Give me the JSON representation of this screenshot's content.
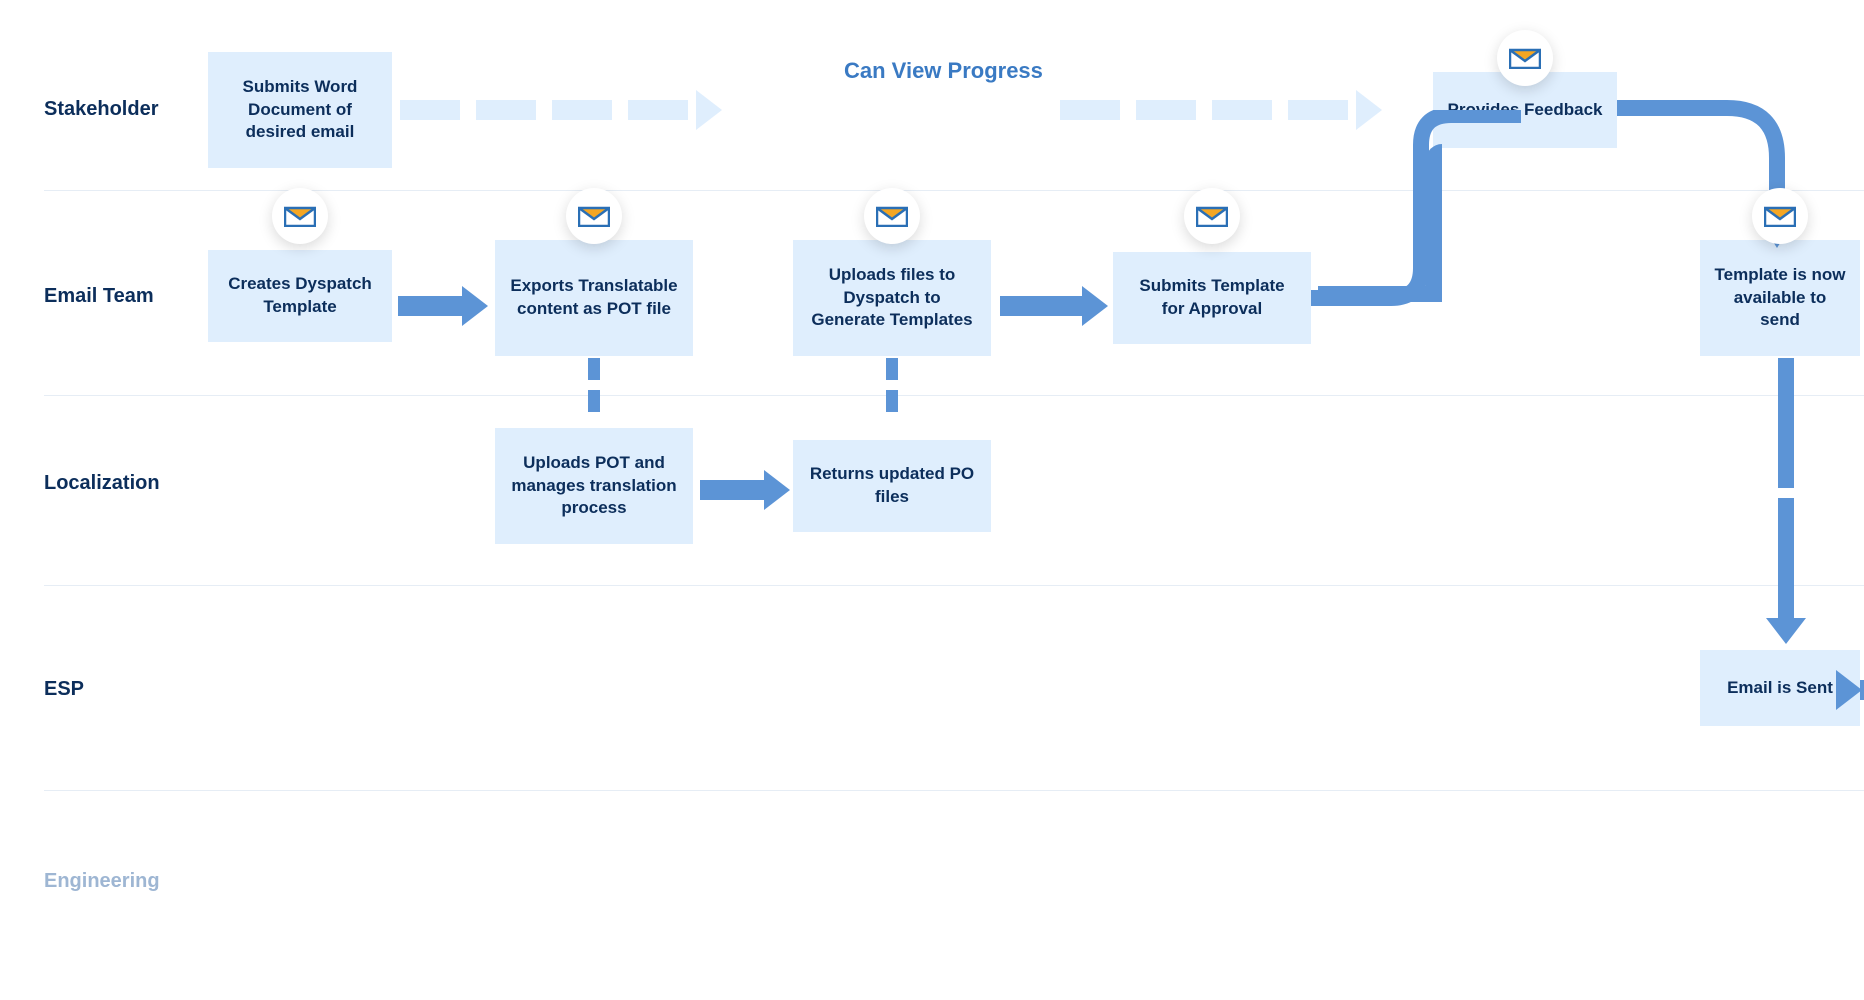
{
  "colors": {
    "box_bg": "#dfeefd",
    "text_dark": "#0c2e5b",
    "arrow_blue": "#5c94d6",
    "progress_blue": "#3a7ac3",
    "faded": "#9eb6d3",
    "divider": "#e6edf5"
  },
  "lanes": {
    "stakeholder": "Stakeholder",
    "email_team": "Email Team",
    "localization": "Localization",
    "esp": "ESP",
    "engineering": "Engineering"
  },
  "progress_label": "Can View Progress",
  "boxes": {
    "stakeholder_submit": "Submits Word Document of desired email",
    "stakeholder_feedback": "Provides Feedback",
    "email_creates": "Creates Dyspatch Template",
    "email_exports": "Exports Translatable content as POT file",
    "email_uploads": "Uploads files to Dyspatch to Generate Templates",
    "email_submits_approval": "Submits Template for Approval",
    "email_available": "Template is now available to send",
    "loc_uploads": "Uploads POT and manages translation process",
    "loc_returns": "Returns updated PO files",
    "esp_sent": "Email is Sent"
  }
}
